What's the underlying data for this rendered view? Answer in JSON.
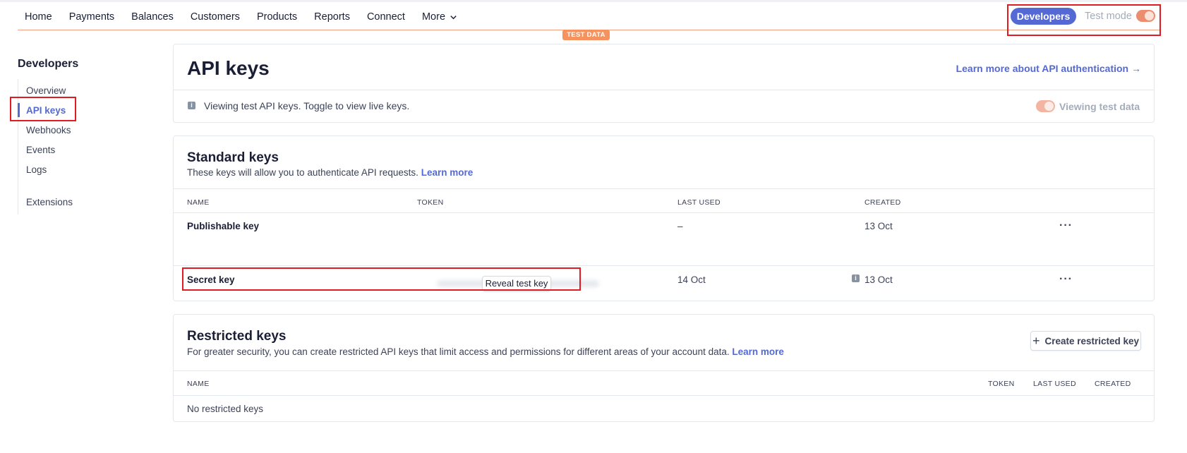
{
  "nav": {
    "items": [
      "Home",
      "Payments",
      "Balances",
      "Customers",
      "Products",
      "Reports",
      "Connect",
      "More"
    ],
    "developers_label": "Developers",
    "test_mode_label": "Test mode",
    "test_data_badge": "TEST DATA"
  },
  "sidebar": {
    "title": "Developers",
    "items": [
      {
        "label": "Overview"
      },
      {
        "label": "API keys"
      },
      {
        "label": "Webhooks"
      },
      {
        "label": "Events"
      },
      {
        "label": "Logs"
      },
      {
        "label": "Extensions"
      }
    ],
    "active": "API keys"
  },
  "header": {
    "title": "API keys",
    "learn_more_link": "Learn more about API authentication →",
    "notice": "Viewing test API keys. Toggle to view live keys.",
    "viewing_label": "Viewing test data"
  },
  "standard_keys": {
    "title": "Standard keys",
    "description": "These keys will allow you to authenticate API requests.",
    "learn_more": "Learn more",
    "columns": [
      "NAME",
      "TOKEN",
      "LAST USED",
      "CREATED"
    ],
    "rows": [
      {
        "name": "Publishable key",
        "last_used": "–",
        "created": "13 Oct"
      },
      {
        "name": "Secret key",
        "reveal_label": "Reveal test key",
        "last_used": "14 Oct",
        "created": "13 Oct"
      }
    ]
  },
  "restricted_keys": {
    "title": "Restricted keys",
    "description": "For greater security, you can create restricted API keys that limit access and permissions for different areas of your account data.",
    "learn_more": "Learn more",
    "create_button": "Create restricted key",
    "columns": [
      "NAME",
      "TOKEN",
      "LAST USED",
      "CREATED"
    ],
    "empty_text": "No restricted keys"
  },
  "colors": {
    "accent": "#5469d4",
    "test_orange": "#f5925e",
    "highlight_red": "#e01b22"
  }
}
